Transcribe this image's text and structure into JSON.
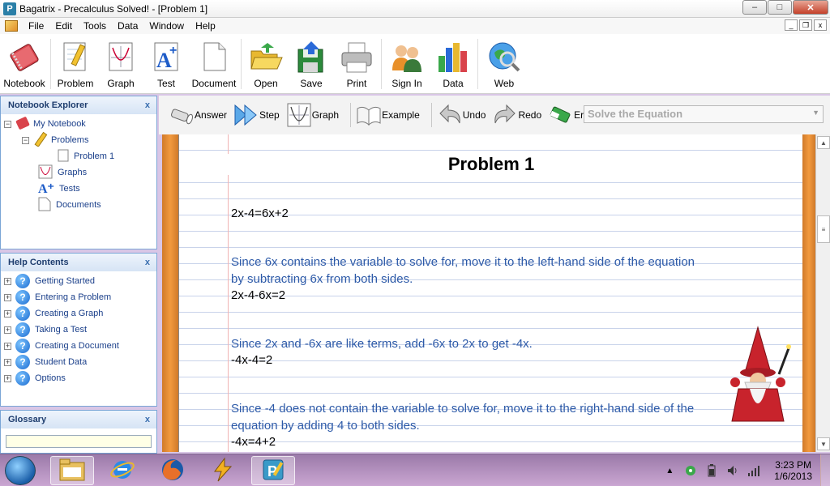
{
  "window": {
    "app_icon_letter": "P",
    "title": "Bagatrix - Precalculus Solved! - [Problem 1]",
    "minimize": "–",
    "maximize": "□",
    "close": "✕"
  },
  "menu": {
    "items": [
      "File",
      "Edit",
      "Tools",
      "Data",
      "Window",
      "Help"
    ],
    "mdi_minimize": "_",
    "mdi_restore": "❐",
    "mdi_close": "x"
  },
  "toolbar": {
    "items": [
      {
        "label": "Notebook",
        "icon": "notebook-icon"
      },
      {
        "label": "Problem",
        "icon": "problem-icon"
      },
      {
        "label": "Graph",
        "icon": "graph-icon"
      },
      {
        "label": "Test",
        "icon": "test-icon"
      },
      {
        "label": "Document",
        "icon": "document-icon"
      },
      {
        "label": "Open",
        "icon": "open-folder-icon"
      },
      {
        "label": "Save",
        "icon": "save-icon"
      },
      {
        "label": "Print",
        "icon": "printer-icon"
      },
      {
        "label": "Sign In",
        "icon": "users-icon"
      },
      {
        "label": "Data",
        "icon": "bar-chart-icon"
      },
      {
        "label": "Web",
        "icon": "web-globe-icon"
      }
    ]
  },
  "notebook_explorer": {
    "title": "Notebook Explorer",
    "close": "x",
    "tree": [
      {
        "label": "My Notebook",
        "expander": "−"
      },
      {
        "label": "Problems",
        "expander": "−"
      },
      {
        "label": "Problem 1"
      },
      {
        "label": "Graphs"
      },
      {
        "label": "Tests"
      },
      {
        "label": "Documents"
      }
    ]
  },
  "help_contents": {
    "title": "Help Contents",
    "close": "x",
    "items": [
      {
        "label": "Getting Started",
        "expander": "+"
      },
      {
        "label": "Entering a Problem",
        "expander": "+"
      },
      {
        "label": "Creating a Graph",
        "expander": "+"
      },
      {
        "label": "Taking a Test",
        "expander": "+"
      },
      {
        "label": "Creating a Document",
        "expander": "+"
      },
      {
        "label": "Student Data",
        "expander": "+"
      },
      {
        "label": "Options",
        "expander": "+"
      }
    ]
  },
  "glossary": {
    "title": "Glossary",
    "close": "x",
    "input_value": ""
  },
  "action_bar": {
    "answer": "Answer",
    "step": "Step",
    "graph": "Graph",
    "example": "Example",
    "undo": "Undo",
    "redo": "Redo",
    "erase": "Erase",
    "solve_select": "Solve the Equation"
  },
  "notebook": {
    "title": "Problem 1",
    "lines": [
      {
        "text": "2x-4=6x+2",
        "kind": "math"
      },
      {
        "text": "Since 6x contains the variable to solve for, move it to the left-hand side of the equation",
        "kind": "expl"
      },
      {
        "text": "by subtracting 6x from both sides.",
        "kind": "expl"
      },
      {
        "text": "2x-4-6x=2",
        "kind": "math"
      },
      {
        "text": "Since 2x and -6x are like terms, add -6x to 2x to get -4x.",
        "kind": "expl"
      },
      {
        "text": "-4x-4=2",
        "kind": "math"
      },
      {
        "text": "Since -4 does not contain the variable to solve for, move it to the right-hand side of the",
        "kind": "expl"
      },
      {
        "text": "equation by adding 4 to both sides.",
        "kind": "expl"
      },
      {
        "text": "-4x=4+2",
        "kind": "math"
      }
    ]
  },
  "taskbar": {
    "apps": [
      "explorer-folder-icon",
      "internet-explorer-icon",
      "firefox-icon",
      "winamp-icon",
      "bagatrix-icon"
    ],
    "time": "3:23 PM",
    "date": "1/6/2013",
    "tray_arrow": "▲"
  },
  "colors": {
    "explanation_text": "#2d5aa8",
    "panel_border": "#7aa5d6",
    "notebook_binding": "#f29a3e",
    "taskbar": "#b895c3"
  }
}
